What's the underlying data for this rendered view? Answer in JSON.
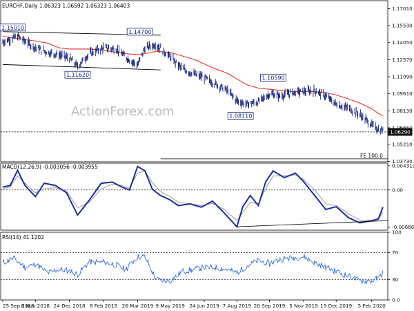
{
  "chart_data": [
    {
      "type": "line",
      "name": "price",
      "header": "EURCHF,Daily  1.06323 1.06592 1.06323 1.06403",
      "watermark": "ActionForex.com",
      "y_ticks": [
        "1.17010",
        "1.15530",
        "1.14050",
        "1.12570",
        "1.11090",
        "1.09610",
        "1.08130",
        "1.06650",
        "1.05210",
        "1.03730"
      ],
      "ylim": [
        1.037,
        1.177
      ],
      "current_price_label": "1.06290",
      "current_price": 1.0629,
      "fe_label": "FE 100.0",
      "fe_level": 1.0395,
      "annotations": [
        {
          "text": "1.15010",
          "date": "2018-09-25",
          "price": 1.1501
        },
        {
          "text": "1.14700",
          "date": "2019-03-29",
          "price": 1.147
        },
        {
          "text": "1.11620",
          "date": "2019-01-04",
          "price": 1.1162
        },
        {
          "text": "1.10590",
          "date": "2019-09-25",
          "price": 1.1059
        },
        {
          "text": "1.08110",
          "date": "2019-08-12",
          "price": 1.0811
        }
      ],
      "channel_lines": [
        {
          "from": {
            "date": "2018-09-25",
            "price": 1.1501
          },
          "to": {
            "date": "2019-04-26",
            "price": 1.147
          }
        },
        {
          "from": {
            "date": "2018-09-25",
            "price": 1.1215
          },
          "to": {
            "date": "2019-04-26",
            "price": 1.1168
          }
        }
      ],
      "close": {
        "dates": [
          "2018-09-25",
          "2018-10-15",
          "2018-11-08",
          "2018-11-25",
          "2018-12-10",
          "2018-12-24",
          "2019-01-04",
          "2019-01-20",
          "2019-02-08",
          "2019-02-25",
          "2019-03-10",
          "2019-03-26",
          "2019-04-05",
          "2019-04-20",
          "2019-05-09",
          "2019-05-25",
          "2019-06-10",
          "2019-06-24",
          "2019-07-08",
          "2019-07-25",
          "2019-08-07",
          "2019-08-20",
          "2019-09-05",
          "2019-09-20",
          "2019-10-05",
          "2019-10-20",
          "2019-11-05",
          "2019-11-20",
          "2019-12-05",
          "2019-12-19",
          "2020-01-03",
          "2020-01-20",
          "2020-02-05",
          "2020-02-14",
          "2020-02-20"
        ],
        "values": [
          1.141,
          1.146,
          1.136,
          1.132,
          1.13,
          1.127,
          1.12,
          1.131,
          1.136,
          1.135,
          1.128,
          1.121,
          1.136,
          1.139,
          1.128,
          1.118,
          1.113,
          1.11,
          1.105,
          1.099,
          1.09,
          1.087,
          1.089,
          1.096,
          1.094,
          1.097,
          1.098,
          1.099,
          1.094,
          1.087,
          1.084,
          1.078,
          1.069,
          1.065,
          1.064
        ]
      },
      "ma": {
        "values": [
          1.146,
          1.144,
          1.142,
          1.14,
          1.136,
          1.135,
          1.135,
          1.135,
          1.134,
          1.132,
          1.131,
          1.13,
          1.131,
          1.133,
          1.132,
          1.129,
          1.126,
          1.122,
          1.118,
          1.114,
          1.109,
          1.104,
          1.101,
          1.1,
          1.099,
          1.098,
          1.098,
          1.098,
          1.097,
          1.095,
          1.092,
          1.088,
          1.083,
          1.079,
          1.077
        ]
      },
      "x_labels": [
        "25 Sep 2018",
        "8 Nov 2018",
        "24 Dec 2018",
        "8 Feb 2019",
        "26 Mar 2019",
        "9 May 2019",
        "24 Jun 2019",
        "7 Aug 2019",
        "20 Sep 2019",
        "5 Nov 2019",
        "19 Dec 2019",
        "5 Feb 2020"
      ],
      "x_label_dates": [
        "2018-09-25",
        "2018-11-08",
        "2018-12-24",
        "2019-02-08",
        "2019-03-26",
        "2019-05-09",
        "2019-06-24",
        "2019-08-07",
        "2019-09-20",
        "2019-11-05",
        "2019-12-19",
        "2020-02-05"
      ]
    },
    {
      "type": "line",
      "name": "macd",
      "header": "MACD(12,26,9) -0.003056 -0.003955",
      "y_ticks": [
        "0.004319",
        "0.00",
        "-0.006663"
      ],
      "ylim": [
        -0.0072,
        0.0048
      ],
      "macd": {
        "dates": [
          "2018-09-25",
          "2018-10-05",
          "2018-10-15",
          "2018-10-25",
          "2018-11-08",
          "2018-11-20",
          "2018-12-05",
          "2018-12-20",
          "2019-01-04",
          "2019-01-20",
          "2019-02-05",
          "2019-02-20",
          "2019-03-05",
          "2019-03-15",
          "2019-03-26",
          "2019-04-05",
          "2019-04-15",
          "2019-04-26",
          "2019-05-09",
          "2019-05-20",
          "2019-06-05",
          "2019-06-20",
          "2019-07-05",
          "2019-07-20",
          "2019-08-07",
          "2019-08-15",
          "2019-08-25",
          "2019-09-05",
          "2019-09-15",
          "2019-09-25",
          "2019-10-10",
          "2019-10-25",
          "2019-11-05",
          "2019-11-20",
          "2019-12-05",
          "2019-12-19",
          "2020-01-05",
          "2020-01-20",
          "2020-02-05",
          "2020-02-14",
          "2020-02-20"
        ],
        "values": [
          0.0005,
          0.0008,
          0.0035,
          0.0008,
          -0.0012,
          0.0012,
          0.0008,
          -0.0005,
          -0.0045,
          -0.0018,
          0.0012,
          0.0014,
          0.0005,
          0.0,
          0.0042,
          0.0034,
          0.0001,
          -0.001,
          -0.0018,
          -0.0028,
          -0.0025,
          -0.0031,
          -0.002,
          -0.004,
          -0.0066,
          -0.003,
          -0.001,
          -0.0028,
          0.0015,
          0.0034,
          0.0022,
          0.003,
          0.0015,
          -0.001,
          -0.0035,
          -0.003,
          -0.005,
          -0.0059,
          -0.0055,
          -0.0052,
          -0.0031
        ]
      },
      "signal": {
        "values": [
          0.0002,
          0.0005,
          0.0025,
          0.0012,
          -0.0005,
          0.0002,
          0.0004,
          -0.0002,
          -0.0032,
          -0.0022,
          0.0002,
          0.001,
          0.0008,
          0.0003,
          0.003,
          0.0034,
          0.0013,
          -0.0003,
          -0.0012,
          -0.0022,
          -0.0025,
          -0.0028,
          -0.0024,
          -0.0034,
          -0.0055,
          -0.004,
          -0.0022,
          -0.0025,
          0.0003,
          0.0025,
          0.0025,
          0.0027,
          0.0019,
          0.0,
          -0.0025,
          -0.0028,
          -0.0043,
          -0.0054,
          -0.0055,
          -0.0053,
          -0.004
        ]
      },
      "trend_line": {
        "from": {
          "date": "2019-08-07",
          "value": -0.0066
        },
        "to": {
          "date": "2020-02-20",
          "value": -0.0055
        }
      }
    },
    {
      "type": "line",
      "name": "rsi",
      "header": "RSI(14) 41.1202",
      "y_ticks": [
        "100",
        "70",
        "30",
        "0.0"
      ],
      "ylim": [
        0,
        100
      ],
      "rsi": {
        "dates": [
          "2018-09-25",
          "2018-10-10",
          "2018-10-25",
          "2018-11-08",
          "2018-11-25",
          "2018-12-10",
          "2018-12-24",
          "2019-01-04",
          "2019-01-20",
          "2019-02-08",
          "2019-02-25",
          "2019-03-10",
          "2019-03-26",
          "2019-04-05",
          "2019-04-20",
          "2019-05-09",
          "2019-05-25",
          "2019-06-10",
          "2019-06-24",
          "2019-07-10",
          "2019-07-25",
          "2019-08-07",
          "2019-08-20",
          "2019-09-05",
          "2019-09-20",
          "2019-10-05",
          "2019-10-20",
          "2019-11-05",
          "2019-11-20",
          "2019-12-05",
          "2019-12-19",
          "2020-01-05",
          "2020-01-20",
          "2020-02-05",
          "2020-02-14",
          "2020-02-20"
        ],
        "values": [
          55,
          62,
          48,
          53,
          40,
          45,
          43,
          38,
          56,
          56,
          52,
          45,
          64,
          64,
          30,
          28,
          42,
          45,
          48,
          48,
          45,
          40,
          50,
          58,
          54,
          60,
          62,
          64,
          55,
          48,
          42,
          35,
          28,
          28,
          32,
          41
        ]
      }
    }
  ]
}
